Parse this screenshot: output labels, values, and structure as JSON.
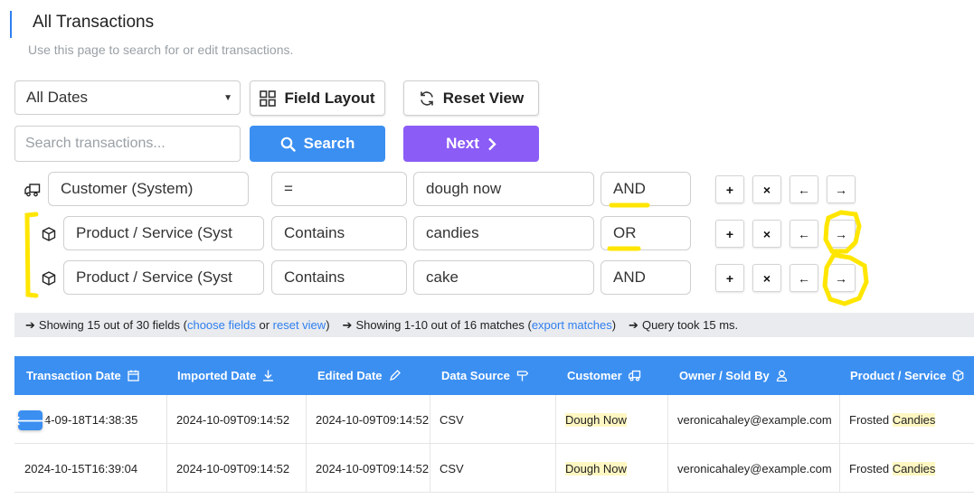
{
  "header": {
    "title": "All Transactions",
    "subtitle": "Use this page to search for or edit transactions."
  },
  "toolbar": {
    "date_filter": "All Dates",
    "field_layout_label": "Field Layout",
    "reset_view_label": "Reset View",
    "search_placeholder": "Search transactions...",
    "search_label": "Search",
    "next_label": "Next"
  },
  "rules": [
    {
      "icon": "truck-icon",
      "field": "Customer (System)",
      "operator": "=",
      "value": "dough now",
      "logic": "AND"
    },
    {
      "icon": "box-icon",
      "field": "Product / Service (Syst",
      "operator": "Contains",
      "value": "candies",
      "logic": "OR"
    },
    {
      "icon": "box-icon",
      "field": "Product / Service (Syst",
      "operator": "Contains",
      "value": "cake",
      "logic": "AND"
    }
  ],
  "rule_buttons": {
    "add": "+",
    "remove": "×",
    "left": "←",
    "right": "→"
  },
  "info": {
    "fields_prefix": "Showing 15 out of 30 fields (",
    "choose_fields": "choose fields",
    "or": " or ",
    "reset_view": "reset view",
    "fields_suffix": ")",
    "matches_prefix": "Showing 1-10 out of 16 matches (",
    "export_matches": "export matches",
    "matches_suffix": ")",
    "query_time": "Query took 15 ms."
  },
  "table": {
    "columns": [
      {
        "label": "Transaction Date",
        "icon": "calendar-icon"
      },
      {
        "label": "Imported Date",
        "icon": "download-icon"
      },
      {
        "label": "Edited Date",
        "icon": "pencil-icon"
      },
      {
        "label": "Data Source",
        "icon": "signpost-icon"
      },
      {
        "label": "Customer",
        "icon": "truck-icon"
      },
      {
        "label": "Owner / Sold By",
        "icon": "user-icon"
      },
      {
        "label": "Product / Service",
        "icon": "box-icon"
      }
    ],
    "rows": [
      {
        "transaction_date": "4-09-18T14:38:35",
        "imported_date": "2024-10-09T09:14:52",
        "edited_date": "2024-10-09T09:14:52",
        "data_source": "CSV",
        "customer": "Dough Now",
        "owner": "veronicahaley@example.com",
        "product_prefix": "Frosted ",
        "product_match": "Candies"
      },
      {
        "transaction_date": "2024-10-15T16:39:04",
        "imported_date": "2024-10-09T09:14:52",
        "edited_date": "2024-10-09T09:14:52",
        "data_source": "CSV",
        "customer": "Dough Now",
        "owner": "veronicahaley@example.com",
        "product_prefix": "Frosted ",
        "product_match": "Candies"
      }
    ]
  },
  "colors": {
    "primary": "#3b8ff1",
    "next": "#8b5cf6",
    "highlight": "#fff7c2",
    "annotation": "#ffe600"
  }
}
